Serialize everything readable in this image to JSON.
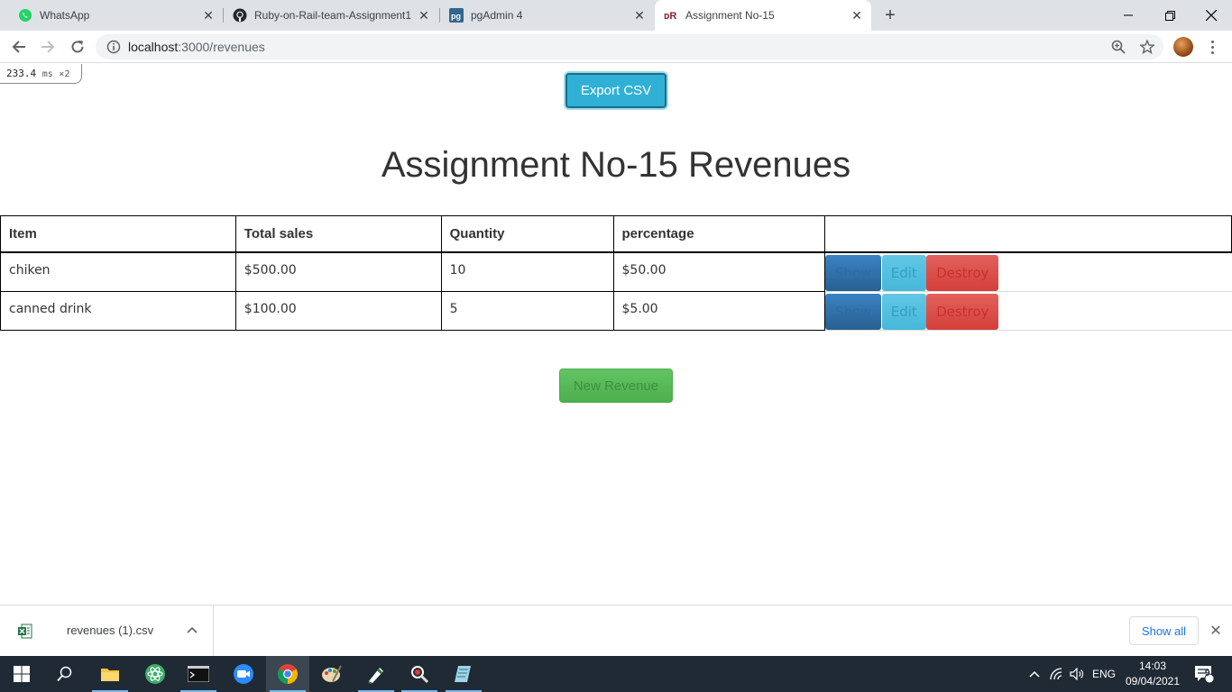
{
  "browser": {
    "tabs": [
      {
        "title": "WhatsApp",
        "icon": "whatsapp-icon"
      },
      {
        "title": "Ruby-on-Rail-team-Assignment1",
        "icon": "github-icon"
      },
      {
        "title": "pgAdmin 4",
        "icon": "pgadmin-icon"
      },
      {
        "title": "Assignment No-15",
        "icon": "rails-icon",
        "active": true
      }
    ],
    "url_host": "localhost",
    "url_path": ":3000/revenues"
  },
  "profiler": {
    "time": "233.4",
    "unit": "ms",
    "count": "×2"
  },
  "page": {
    "export_label": "Export CSV",
    "title": "Assignment No-15 Revenues",
    "new_label": "New Revenue",
    "table": {
      "headers": [
        "Item",
        "Total sales",
        "Quantity",
        "percentage"
      ],
      "rows": [
        {
          "item": "chiken",
          "total_sales": "$500.00",
          "quantity": "10",
          "percentage": "$50.00"
        },
        {
          "item": "canned drink",
          "total_sales": "$100.00",
          "quantity": "5",
          "percentage": "$5.00"
        }
      ],
      "actions": {
        "show": "Show",
        "edit": "Edit",
        "destroy": "Destroy"
      }
    }
  },
  "downloads": {
    "file_name": "revenues (1).csv",
    "show_all": "Show all"
  },
  "taskbar": {
    "language": "ENG",
    "time": "14:03",
    "date": "09/04/2021",
    "notifications": "9"
  },
  "colors": {
    "export": "#31b0d5",
    "show": "#337ab7",
    "edit": "#5bc0de",
    "destroy": "#d9534f",
    "new": "#5cb85c"
  }
}
